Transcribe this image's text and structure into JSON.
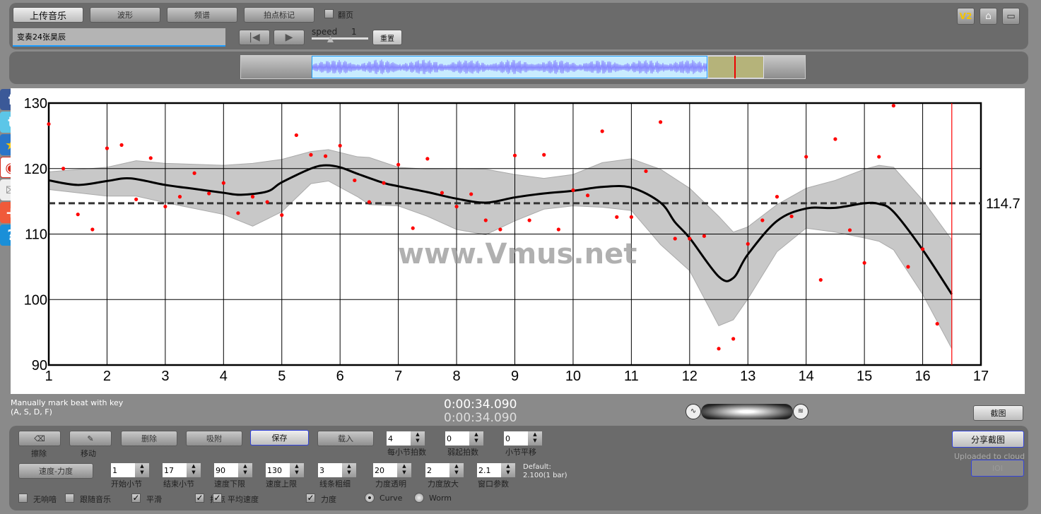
{
  "toolbar": {
    "upload": "上传音乐",
    "waveform": "波形",
    "spectrum": "频谱",
    "beat_mark": "拍点标记",
    "page_turn": "翻页",
    "page_turn_checked": false,
    "title_value": "变奏24张昊辰",
    "speed_label": "speed",
    "speed_value": "1",
    "reset": "重置",
    "version": "V2"
  },
  "overview": {
    "waveform_color": "#8888ff",
    "selection_color": "#b5b37a",
    "marker_color": "#ff0000"
  },
  "status": {
    "hint_line1": "Manually mark beat with key",
    "hint_line2": "(A, S, D, F)",
    "time1": "0:00:34.090",
    "time2": "0:00:34.090",
    "screenshot": "截图"
  },
  "controls": {
    "erase": "擦除",
    "move": "移动",
    "delete": "删除",
    "snap": "吸附",
    "save": "保存",
    "load": "载入",
    "beats_per_bar": {
      "value": "4",
      "label": "每小节拍数"
    },
    "pickup_beats": {
      "value": "0",
      "label": "弱起拍数"
    },
    "bar_shift": {
      "value": "0",
      "label": "小节平移"
    },
    "mode": "速度-力度",
    "start_bar": {
      "value": "1",
      "label": "开始小节"
    },
    "end_bar": {
      "value": "17",
      "label": "结束小节"
    },
    "tempo_min": {
      "value": "90",
      "label": "速度下限"
    },
    "tempo_max": {
      "value": "130",
      "label": "速度上限"
    },
    "line_width": {
      "value": "3",
      "label": "线条粗细"
    },
    "dyn_alpha": {
      "value": "20",
      "label": "力度透明"
    },
    "dyn_scale": {
      "value": "2",
      "label": "力度放大"
    },
    "window": {
      "value": "2.1",
      "label": "窗口参数"
    },
    "default_line1": "Default:",
    "default_line2": "2.100(1 bar)",
    "checks": [
      {
        "label": "无响喑",
        "checked": false
      },
      {
        "label": "跟随音乐",
        "checked": false
      },
      {
        "label": "平滑",
        "checked": true
      },
      {
        "label": "拍点",
        "checked": true
      },
      {
        "label": "平均速度",
        "checked": true
      },
      {
        "label": "力度",
        "checked": true
      }
    ],
    "radios": [
      {
        "label": "Curve",
        "selected": true
      },
      {
        "label": "Worm",
        "selected": false
      }
    ],
    "share": "分享截图",
    "uploaded": "Uploaded to cloud",
    "ioi": "IOI"
  },
  "social": [
    "facebook",
    "twitter",
    "qzone",
    "weibo",
    "email",
    "add",
    "help"
  ],
  "watermark": "www.Vmus.net",
  "chart_data": {
    "type": "scatter",
    "xlim": [
      1,
      17
    ],
    "ylim": [
      90,
      130
    ],
    "xticks": [
      "1",
      "2",
      "3",
      "4",
      "5",
      "6",
      "7",
      "8",
      "9",
      "10",
      "11",
      "12",
      "13",
      "14",
      "15",
      "16",
      "17"
    ],
    "yticks": [
      "90",
      "100",
      "110",
      "120",
      "130"
    ],
    "grid": true,
    "mean": 114.7,
    "mean_label": "114.7",
    "cursor_x": 16.5,
    "point_color": "#ff0000",
    "points_x_start": 1,
    "points_x_step": 0.25,
    "points_y": [
      126.8,
      120.0,
      113.0,
      110.7,
      123.1,
      123.6,
      115.3,
      121.6,
      114.2,
      115.7,
      119.3,
      116.2,
      117.8,
      113.2,
      115.7,
      114.9,
      112.9,
      125.1,
      122.1,
      121.9,
      123.5,
      118.2,
      114.9,
      117.8,
      120.6,
      110.9,
      121.5,
      116.3,
      114.2,
      116.1,
      112.1,
      110.7,
      122.0,
      112.1,
      122.1,
      110.7,
      116.7,
      115.9,
      125.7,
      112.6,
      112.6,
      119.6,
      127.1,
      109.3,
      109.3,
      109.7,
      92.5,
      94.0,
      108.5,
      112.1,
      115.7,
      112.7,
      121.8,
      103.0,
      124.5,
      110.6,
      105.6,
      121.8,
      129.6,
      105.0,
      107.7,
      96.3
    ],
    "curve": [
      [
        1,
        118.2
      ],
      [
        1.5,
        117.5
      ],
      [
        2,
        118.1
      ],
      [
        2.4,
        118.5
      ],
      [
        3,
        117.5
      ],
      [
        3.5,
        116.9
      ],
      [
        4,
        116.3
      ],
      [
        4.3,
        116.0
      ],
      [
        4.75,
        116.5
      ],
      [
        5,
        117.9
      ],
      [
        5.5,
        120.0
      ],
      [
        5.75,
        120.5
      ],
      [
        6,
        120.2
      ],
      [
        6.3,
        119.2
      ],
      [
        6.75,
        117.8
      ],
      [
        7,
        117.3
      ],
      [
        7.5,
        116.4
      ],
      [
        8,
        115.4
      ],
      [
        8.5,
        114.8
      ],
      [
        9,
        115.6
      ],
      [
        9.5,
        116.2
      ],
      [
        10,
        116.6
      ],
      [
        10.5,
        117.2
      ],
      [
        11,
        117.1
      ],
      [
        11.5,
        114.8
      ],
      [
        11.75,
        111.8
      ],
      [
        12,
        109.4
      ],
      [
        12.5,
        103.5
      ],
      [
        12.75,
        103.3
      ],
      [
        13,
        106.9
      ],
      [
        13.5,
        112.0
      ],
      [
        14,
        113.9
      ],
      [
        14.5,
        114.0
      ],
      [
        15,
        114.7
      ],
      [
        15.25,
        114.6
      ],
      [
        15.5,
        113.4
      ],
      [
        16,
        107.6
      ],
      [
        16.5,
        100.8
      ]
    ],
    "band": [
      [
        1,
        119.5,
        116.8
      ],
      [
        2,
        120.2,
        115.8
      ],
      [
        2.5,
        121.2,
        115.8
      ],
      [
        3,
        120.8,
        114.8
      ],
      [
        4,
        120.5,
        113.0
      ],
      [
        4.5,
        120.8,
        111.2
      ],
      [
        5,
        121.4,
        113.4
      ],
      [
        5.5,
        122.6,
        117.7
      ],
      [
        5.8,
        122.9,
        118.1
      ],
      [
        6.3,
        121.8,
        115.7
      ],
      [
        6.5,
        121.7,
        114.5
      ],
      [
        7,
        120.2,
        114.3
      ],
      [
        7.5,
        119.9,
        112.7
      ],
      [
        8,
        120.0,
        110.7
      ],
      [
        8.5,
        119.9,
        109.9
      ],
      [
        9,
        119.1,
        112.0
      ],
      [
        9.5,
        118.5,
        113.8
      ],
      [
        10,
        119.1,
        114.3
      ],
      [
        10.5,
        120.9,
        114.1
      ],
      [
        11,
        121.5,
        113.6
      ],
      [
        11.5,
        119.9,
        108.4
      ],
      [
        12,
        117.0,
        104.4
      ],
      [
        12.5,
        112.7,
        96.0
      ],
      [
        12.75,
        110.3,
        96.9
      ],
      [
        13,
        111.1,
        100.1
      ],
      [
        13.5,
        114.5,
        107.3
      ],
      [
        14,
        117.0,
        110.9
      ],
      [
        14.5,
        118.2,
        110.3
      ],
      [
        15,
        119.9,
        109.4
      ],
      [
        15.25,
        120.5,
        108.9
      ],
      [
        15.5,
        120.2,
        107.6
      ],
      [
        16,
        115.2,
        100.8
      ],
      [
        16.5,
        109.1,
        92.5
      ]
    ]
  }
}
